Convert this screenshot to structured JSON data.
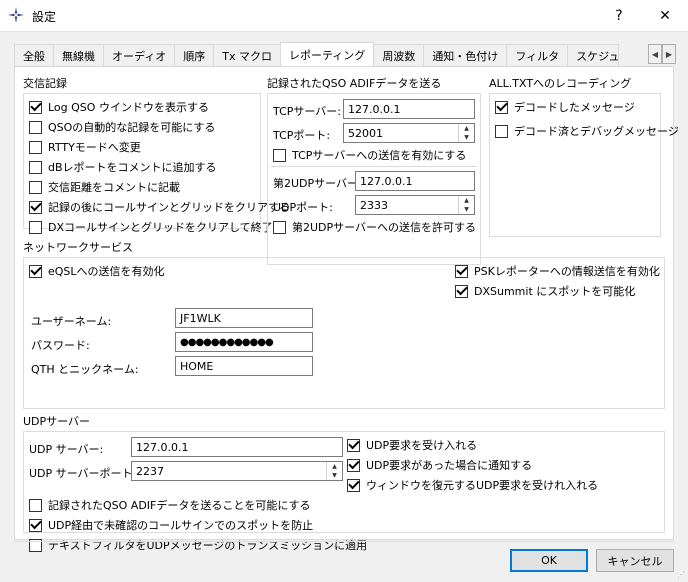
{
  "window": {
    "title": "設定",
    "help_label": "?",
    "close_label": "✕"
  },
  "tabs": [
    "全般",
    "無線機",
    "オーディオ",
    "順序",
    "Tx マクロ",
    "レポーティング",
    "周波数",
    "通知・色付け",
    "フィルタ",
    "スケジュ"
  ],
  "tab_scroll": {
    "left": "◀",
    "right": "▶"
  },
  "qso_log": {
    "title": "交信記録",
    "items": [
      {
        "label": "Log QSO ウインドウを表示する",
        "checked": true
      },
      {
        "label": "QSOの自動的な記録を可能にする",
        "checked": false
      },
      {
        "label": "RTTYモードへ変更",
        "checked": false
      },
      {
        "label": "dBレポートをコメントに追加する",
        "checked": false
      },
      {
        "label": "交信距離をコメントに記載",
        "checked": false
      },
      {
        "label": "記録の後にコールサインとグリッドをクリアする",
        "checked": true
      },
      {
        "label": "DXコールサインとグリッドをクリアして終了",
        "checked": false
      }
    ]
  },
  "adif_send": {
    "title": "記録されたQSO ADIFデータを送る",
    "tcp_server_label": "TCPサーバー:",
    "tcp_server_value": "127.0.0.1",
    "tcp_port_label": "TCPポート:",
    "tcp_port_value": "52001",
    "tcp_enable_label": "TCPサーバーへの送信を有効にする",
    "tcp_enable_checked": false,
    "udp2_server_label": "第2UDPサーバー",
    "udp2_server_value": "127.0.0.1",
    "udp2_port_label": "UDPポート:",
    "udp2_port_value": "2333",
    "udp2_enable_label": "第2UDPサーバーへの送信を許可する",
    "udp2_enable_checked": false
  },
  "alltxt": {
    "title": "ALL.TXTへのレコーディング",
    "items": [
      {
        "label": "デコードしたメッセージ",
        "checked": true
      },
      {
        "label": "デコード済とデバッグメッセージ",
        "checked": false
      }
    ]
  },
  "network": {
    "title": "ネットワークサービス",
    "eqsl_label": "eQSLへの送信を有効化",
    "eqsl_checked": true,
    "psk_label": "PSKレポーターへの情報送信を有効化",
    "psk_checked": true,
    "dxsummit_label": "DXSummit にスポットを可能化",
    "dxsummit_checked": true,
    "username_label": "ユーザーネーム:",
    "username_value": "JF1WLK",
    "password_label": "パスワード:",
    "password_value": "●●●●●●●●●●●●",
    "qth_label": "QTH とニックネーム:",
    "qth_value": "HOME"
  },
  "udp_server": {
    "title": "UDPサーバー",
    "server_label": "UDP サーバー:",
    "server_value": "127.0.0.1",
    "port_label": "UDP サーバーポート:",
    "port_value": "2237",
    "accept_label": "UDP要求を受け入れる",
    "accept_checked": true,
    "notify_label": "UDP要求があった場合に通知する",
    "notify_checked": true,
    "restore_label": "ウィンドウを復元するUDP要求を受けれ入れる",
    "restore_checked": true,
    "adif_label": "記録されたQSO ADIFデータを送ることを可能にする",
    "adif_checked": false,
    "prevent_label": "UDP経由で未確認のコールサインでのスポットを防止",
    "prevent_checked": true,
    "textfilter_label": "テキストフィルタをUDPメッセージのトランスミッションに適用",
    "textfilter_checked": false
  },
  "buttons": {
    "ok": "OK",
    "cancel": "キャンセル"
  }
}
